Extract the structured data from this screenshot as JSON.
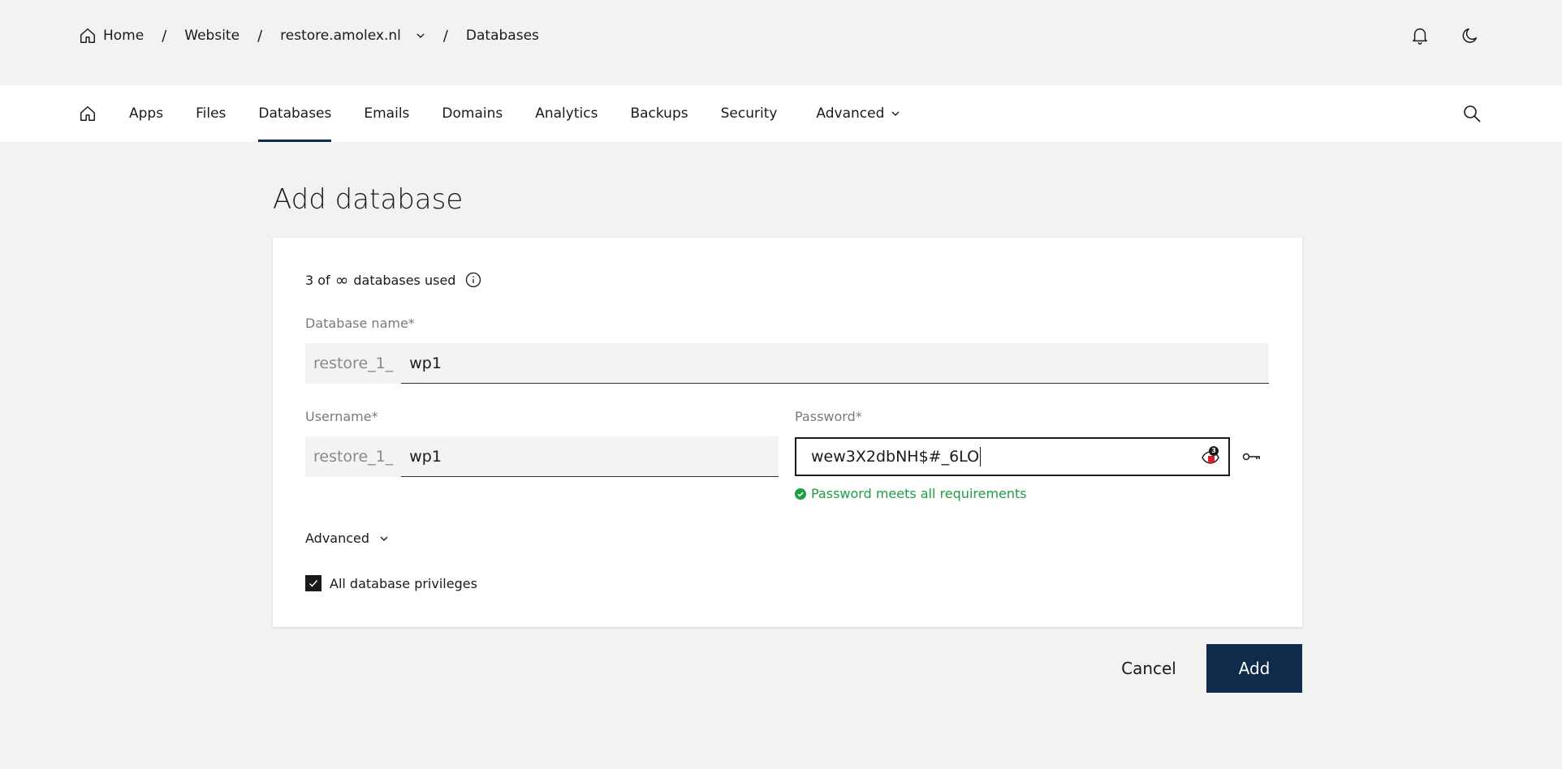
{
  "breadcrumb": {
    "items": [
      {
        "label": "Home",
        "icon": "home-icon"
      },
      {
        "label": "Website"
      },
      {
        "label": "restore.amolex.nl",
        "icon": "chevron-down-icon"
      },
      {
        "label": "Databases"
      }
    ],
    "separator": "/"
  },
  "top_actions": {
    "notifications_icon": "bell-icon",
    "theme_icon": "moon-icon"
  },
  "nav": {
    "items": [
      "Apps",
      "Files",
      "Databases",
      "Emails",
      "Domains",
      "Analytics",
      "Backups",
      "Security"
    ],
    "active": "Databases",
    "advanced_label": "Advanced",
    "search_icon": "search-icon"
  },
  "page": {
    "title": "Add database"
  },
  "form": {
    "usage_prefix": "3 of",
    "usage_symbol": "∞",
    "usage_suffix": "databases used",
    "db_name": {
      "label": "Database name*",
      "prefix": "restore_1_",
      "value": "wp1"
    },
    "username": {
      "label": "Username*",
      "prefix": "restore_1_",
      "value": "wp1"
    },
    "password": {
      "label": "Password*",
      "value": "wew3X2dbNH$#_6LO",
      "badge": "3",
      "hint": "Password meets all requirements"
    },
    "advanced_label": "Advanced",
    "privileges_label": "All database privileges",
    "privileges_checked": true
  },
  "actions": {
    "cancel_label": "Cancel",
    "add_label": "Add"
  },
  "colors": {
    "accent": "#0f2a4a",
    "success": "#1e9e44",
    "background": "#f2f2f2"
  }
}
